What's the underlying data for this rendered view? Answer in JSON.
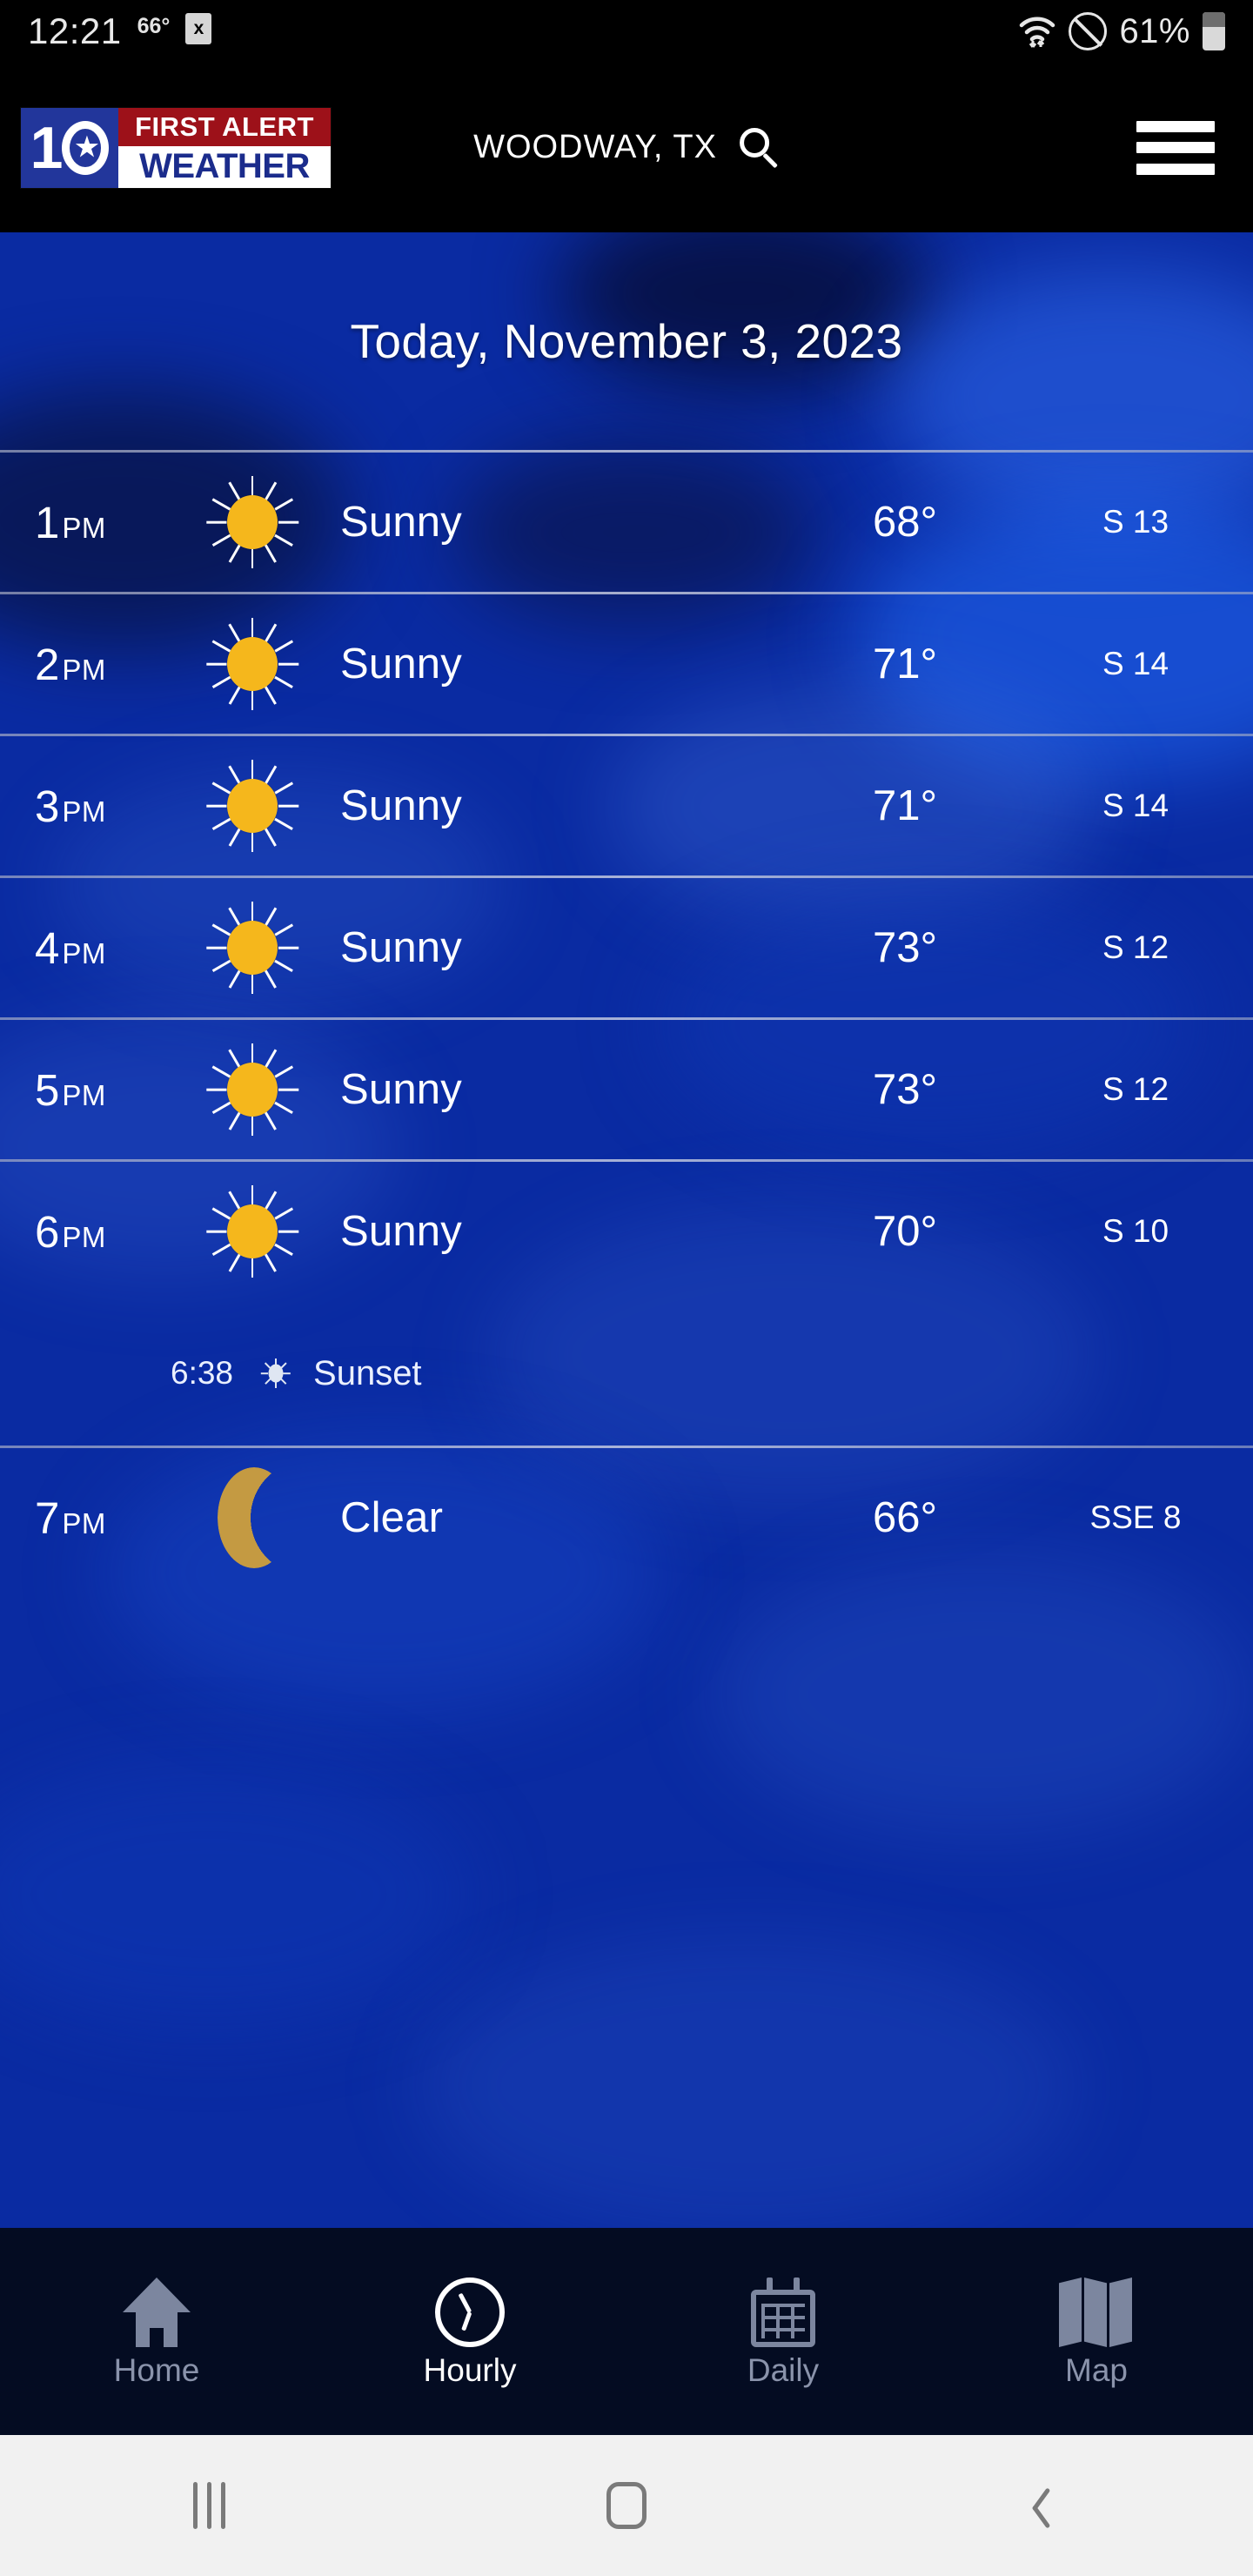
{
  "status_bar": {
    "time": "12:21",
    "temperature": "66°",
    "sim_icon": "x",
    "battery_percent": "61%",
    "icons": [
      "wifi-icon",
      "do-not-disturb-icon",
      "battery-icon"
    ]
  },
  "app_bar": {
    "logo": {
      "channel": "10",
      "line1": "FIRST ALERT",
      "line2": "WEATHER"
    },
    "location": "WOODWAY, TX",
    "search_icon": "search-icon",
    "menu_icon": "hamburger-menu-icon"
  },
  "page": {
    "date_header": "Today, November 3, 2023"
  },
  "hourly": [
    {
      "time": "1",
      "meridiem": "PM",
      "icon": "sun-icon",
      "condition": "Sunny",
      "temp": "68°",
      "wind": "S 13"
    },
    {
      "time": "2",
      "meridiem": "PM",
      "icon": "sun-icon",
      "condition": "Sunny",
      "temp": "71°",
      "wind": "S 14"
    },
    {
      "time": "3",
      "meridiem": "PM",
      "icon": "sun-icon",
      "condition": "Sunny",
      "temp": "71°",
      "wind": "S 14"
    },
    {
      "time": "4",
      "meridiem": "PM",
      "icon": "sun-icon",
      "condition": "Sunny",
      "temp": "73°",
      "wind": "S 12"
    },
    {
      "time": "5",
      "meridiem": "PM",
      "icon": "sun-icon",
      "condition": "Sunny",
      "temp": "73°",
      "wind": "S 12"
    },
    {
      "time": "6",
      "meridiem": "PM",
      "icon": "sun-icon",
      "condition": "Sunny",
      "temp": "70°",
      "wind": "S 10",
      "event": {
        "time": "6:38",
        "icon": "sunset-icon",
        "label": "Sunset"
      }
    },
    {
      "time": "7",
      "meridiem": "PM",
      "icon": "moon-icon",
      "condition": "Clear",
      "temp": "66°",
      "wind": "SSE 8"
    }
  ],
  "bottom_nav": {
    "items": [
      {
        "label": "Home",
        "icon": "home-icon",
        "active": false
      },
      {
        "label": "Hourly",
        "icon": "clock-icon",
        "active": true
      },
      {
        "label": "Daily",
        "icon": "calendar-icon",
        "active": false
      },
      {
        "label": "Map",
        "icon": "map-icon",
        "active": false
      }
    ]
  },
  "android_nav": {
    "recents": "recents-icon",
    "home": "home-pill-icon",
    "back": "back-icon"
  },
  "colors": {
    "brand_red": "#9d1119",
    "brand_blue": "#1b2c8c",
    "sun_yellow": "#f5b71c",
    "moon_gold": "#c49a42",
    "sky_top": "#020625",
    "sky_mid": "#0a31ad",
    "nav_bg": "#040c22",
    "android_nav_bg": "#f1f1f1"
  }
}
